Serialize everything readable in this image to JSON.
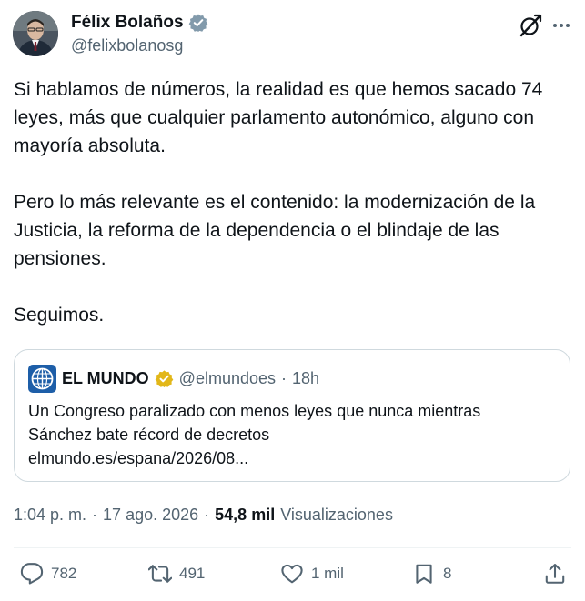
{
  "author": {
    "display_name": "Félix Bolaños",
    "handle": "@felixbolanosg",
    "verified_badge_icon": "verified-gray-badge-icon"
  },
  "tweet": {
    "paragraphs": [
      "Si hablamos de números, la realidad es que hemos sacado 74 leyes, más que cualquier parlamento autonómico, alguno con mayoría absoluta.",
      "Pero lo más relevante es el contenido: la modernización de la Justicia, la reforma de la dependencia o el blindaje de las pensiones.",
      "Seguimos."
    ]
  },
  "quote": {
    "name": "EL MUNDO",
    "handle": "@elmundoes",
    "separator": "·",
    "time": "18h",
    "text_line1": "Un Congreso paralizado con menos leyes que nunca mientras",
    "text_line2": "Sánchez bate récord de decretos",
    "link": "elmundo.es/espana/2026/08..."
  },
  "meta": {
    "time": "1:04 p. m.",
    "date": "17 ago. 2026",
    "separator": "·",
    "views_count": "54,8 mil",
    "views_label": "Visualizaciones"
  },
  "actions": {
    "replies": "782",
    "reposts": "491",
    "likes": "1 mil",
    "bookmarks": "8"
  },
  "colors": {
    "text": "#0f1419",
    "secondary": "#536471",
    "border": "#cfd9de",
    "gold_badge": "#e2b719",
    "gray_badge": "#829aab"
  }
}
